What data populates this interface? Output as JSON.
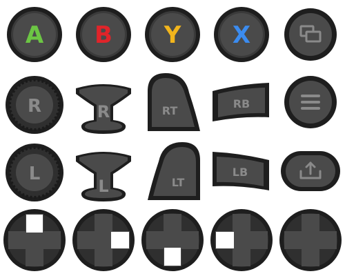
{
  "colors": {
    "outer": "#1e1e1e",
    "rim": "#2f2f2f",
    "face": "#4a4a4a",
    "label": "#8a8a8a",
    "a": "#6cc644",
    "b": "#e0242a",
    "y": "#f2b51c",
    "x": "#3b8cf0",
    "highlight": "#ffffff"
  },
  "face_buttons": {
    "a": "A",
    "b": "B",
    "y": "Y",
    "x": "X"
  },
  "stick_labels": {
    "right": "R",
    "left": "L"
  },
  "triggers": {
    "right": "RT",
    "left": "LT"
  },
  "bumpers": {
    "right": "RB",
    "left": "LB"
  },
  "icons": {
    "view": "view-icon",
    "menu": "menu-icon",
    "share": "share-icon",
    "dpad": "dpad-icon"
  },
  "dpad_states": [
    "up",
    "right",
    "down",
    "left",
    "none"
  ]
}
